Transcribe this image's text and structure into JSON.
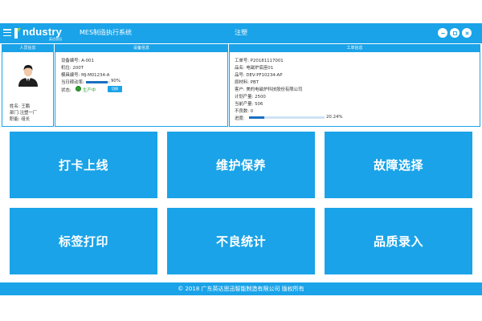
{
  "titlebar": {
    "logo_text": "ndustry",
    "logo_sub": "英达思迅",
    "app_title": "MES制造执行系统",
    "center_title": "注塑",
    "colors": {
      "accent": "#1aa3e8",
      "progress": "#1a6fc0",
      "status_green": "#2e9e2e"
    },
    "icons": [
      "menu-icon",
      "minimize-icon",
      "maximize-icon",
      "close-icon"
    ]
  },
  "person": {
    "header": "人员信息",
    "name_label": "姓名:",
    "name": "王鹏",
    "dept_label": "部门:",
    "dept": "注塑一厂",
    "role_label": "职能:",
    "role": "组长"
  },
  "equipment": {
    "header": "设备信息",
    "code_label": "设备编号:",
    "code": "A-001",
    "station_label": "机位:",
    "station": "200T",
    "mold_label": "模具编号:",
    "mold": "MJ-M01234-A",
    "util_label": "当日稼动率:",
    "util_text": "90%",
    "util_value": 0.9,
    "status_label": "状态:",
    "status": "生产中",
    "status_button": "切换"
  },
  "order": {
    "header": "工单信息",
    "no_label": "工单号:",
    "no": "P20181117001",
    "pname_label": "品名:",
    "pname": "电磁炉底座01",
    "pcode_label": "品号:",
    "pcode": "DEV-PF10234-AP",
    "material_label": "原材料:",
    "material": "PBT",
    "customer_label": "客户:",
    "customer": "美的电磁炉科技股份有限公司",
    "planned_label": "计划产量:",
    "planned": "2500",
    "current_label": "当前产量:",
    "current": "506",
    "defect_label": "不良数:",
    "defect": "0",
    "progress_label": "进度:",
    "progress_text": "20.24%",
    "progress_value": 0.2024
  },
  "tiles": [
    "打卡上线",
    "维护保养",
    "故障选择",
    "标签打印",
    "不良统计",
    "品质录入"
  ],
  "footer": "© 2018 广东英达思迅智能制造有限公司 版权所有"
}
